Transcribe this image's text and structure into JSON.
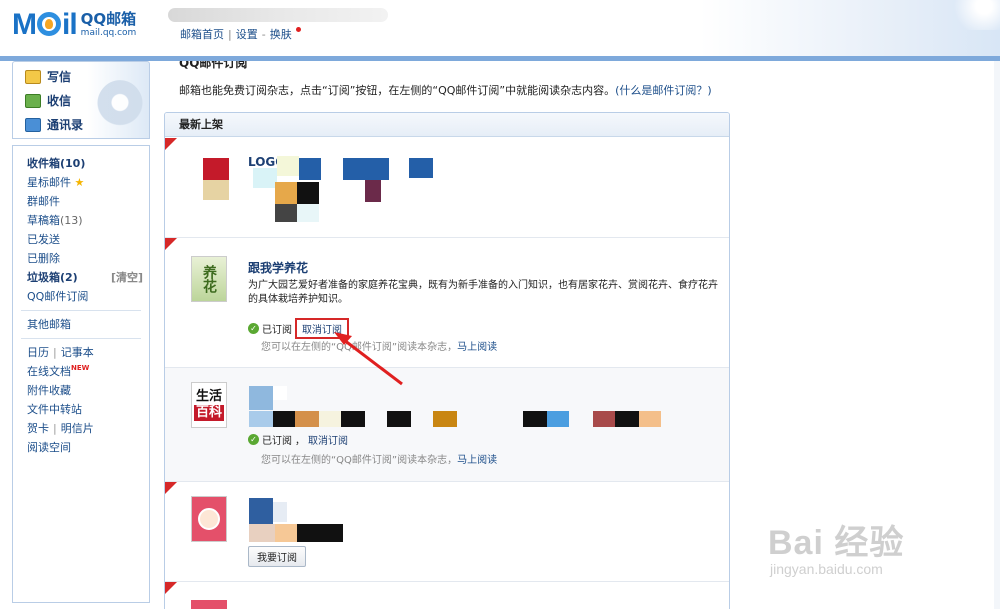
{
  "header": {
    "logo_text": "MOil",
    "brand_cn": "QQ邮箱",
    "brand_url": "mail.qq.com",
    "nav": [
      "邮箱首页",
      "设置",
      "换肤"
    ],
    "nav_sep": "|",
    "nav_dash": "-"
  },
  "sidebar": {
    "quick": [
      {
        "label": "写信",
        "icon": "write-icon"
      },
      {
        "label": "收信",
        "icon": "inbox-download-icon"
      },
      {
        "label": "通讯录",
        "icon": "contacts-icon"
      }
    ],
    "folders": {
      "inbox": "收件箱(10)",
      "starred": "星标邮件",
      "group": "群邮件",
      "drafts": "草稿箱",
      "drafts_count": "(13)",
      "sent": "已发送",
      "deleted": "已删除",
      "spam": "垃圾箱(2)",
      "spam_clean": "[清空]",
      "qq_sub": "QQ邮件订阅",
      "other": "其他邮箱",
      "calendar": "日历",
      "notes": "记事本",
      "online_docs": "在线文档",
      "new_tag": "NEW",
      "attachments": "附件收藏",
      "transfer": "文件中转站",
      "cards": "贺卡",
      "postcards": "明信片",
      "reading": "阅读空间",
      "sep": "|"
    }
  },
  "main": {
    "title": "QQ邮件订阅",
    "desc": "邮箱也能免费订阅杂志，点击“订阅”按钮，在左侧的“QQ邮件订阅”中就能阅读杂志内容。",
    "desc_link": "(什么是邮件订阅？)",
    "panel_title": "最新上架",
    "mag1_title_partial": "LOGO",
    "mag2": {
      "title": "跟我学养花",
      "cover_text": "养花",
      "desc": "为广大园艺爱好者准备的家庭养花宝典，既有为新手准备的入门知识，也有居家花卉、赏阅花卉、食疗花卉的具体栽培养护知识。",
      "status": "已订阅",
      "unsub": "取消订阅",
      "tip": "您可以在左侧的“QQ邮件订阅”阅读本杂志，",
      "read_now": "马上阅读"
    },
    "mag3": {
      "cover_top": "生活",
      "cover_bottom": "百科",
      "status": "已订阅",
      "comma": "，",
      "unsub": "取消订阅",
      "tip": "您可以在左侧的“QQ邮件订阅”阅读本杂志，",
      "read_now": "马上阅读"
    },
    "mag4": {
      "subscribe": "我要订阅"
    }
  },
  "watermark": {
    "brand": "Bai 经验",
    "url": "jingyan.baidu.com"
  },
  "colors": {
    "brand_blue": "#1a72c6",
    "link_blue": "#1c4e8a",
    "annotation_red": "#d62828",
    "subscribed_green": "#5aa832"
  }
}
